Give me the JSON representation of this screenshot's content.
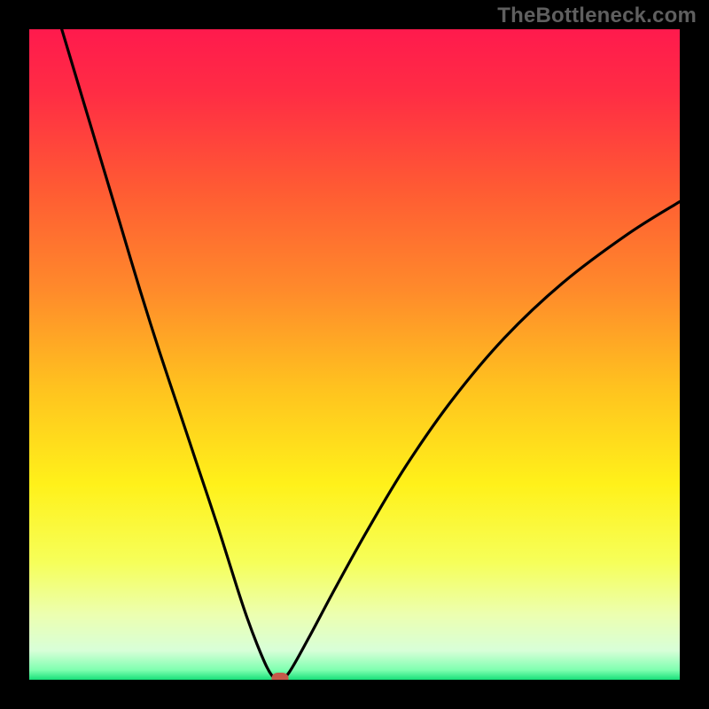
{
  "watermark": "TheBottleneck.com",
  "colors": {
    "frame": "#000000",
    "curve": "#000000",
    "marker": "#c55a4a",
    "watermark": "#5f5f5f",
    "gradient_stops": [
      {
        "offset": 0.0,
        "color": "#ff1a4d"
      },
      {
        "offset": 0.1,
        "color": "#ff2d44"
      },
      {
        "offset": 0.25,
        "color": "#ff5c33"
      },
      {
        "offset": 0.4,
        "color": "#ff8a2b"
      },
      {
        "offset": 0.55,
        "color": "#ffc21f"
      },
      {
        "offset": 0.7,
        "color": "#fff11a"
      },
      {
        "offset": 0.82,
        "color": "#f6ff5a"
      },
      {
        "offset": 0.9,
        "color": "#ecffb0"
      },
      {
        "offset": 0.955,
        "color": "#d8ffd8"
      },
      {
        "offset": 0.985,
        "color": "#7fffb0"
      },
      {
        "offset": 1.0,
        "color": "#18e07a"
      }
    ]
  },
  "chart_data": {
    "type": "line",
    "title": "",
    "xlabel": "",
    "ylabel": "",
    "xlim": [
      0,
      100
    ],
    "ylim": [
      0,
      100
    ],
    "grid": false,
    "legend": false,
    "vertex_x": 37,
    "marker": {
      "x": 38.5,
      "y": 0
    },
    "series": [
      {
        "name": "curve",
        "x": [
          5,
          8,
          11,
          14,
          17,
          20,
          23,
          26,
          29,
          32,
          33.5,
          35,
          36.5,
          37.5,
          38,
          38.7,
          40,
          43,
          47,
          52,
          58,
          65,
          73,
          82,
          92,
          100
        ],
        "y": [
          100,
          90,
          80,
          70,
          60,
          50.5,
          41.5,
          32.5,
          23.5,
          14,
          9.5,
          5.5,
          2,
          0.4,
          0.2,
          0.2,
          1.2,
          6.5,
          14,
          23,
          33,
          43,
          52.5,
          61,
          68.5,
          73.5
        ]
      }
    ]
  }
}
